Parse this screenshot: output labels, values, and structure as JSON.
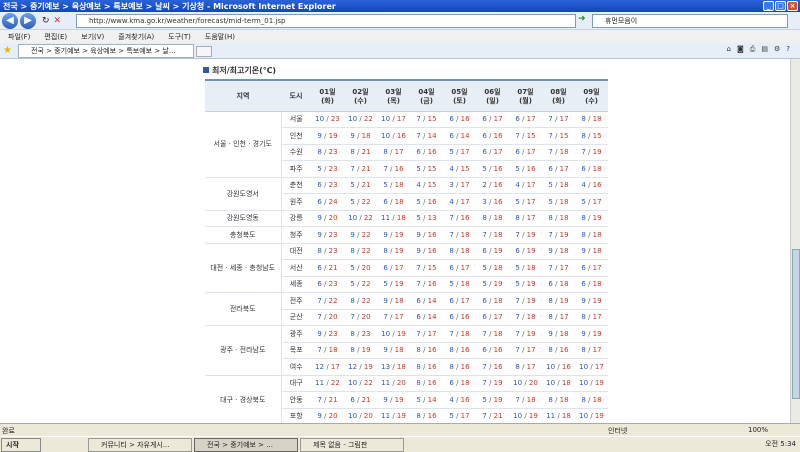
{
  "window": {
    "title": "전국 > 중기예보 > 육상예보 > 특보예보 > 날씨 > 기상청 - Microsoft Internet Explorer"
  },
  "addressbar": {
    "url": "http://www.kma.go.kr/weather/forecast/mid-term_01.jsp",
    "search": "휴먼모음이"
  },
  "menu": [
    "파일(F)",
    "편집(E)",
    "보기(V)",
    "즐겨찾기(A)",
    "도구(T)",
    "도움말(H)"
  ],
  "tab": {
    "label": "전국 > 중기예보 > 육상예보 > 특보예보 > 날..."
  },
  "section": {
    "title": "최저/최고기온(℃)"
  },
  "table": {
    "header_region": "지역",
    "header_city": "도시",
    "days": [
      {
        "day": "01일",
        "dow": "(화)"
      },
      {
        "day": "02일",
        "dow": "(수)"
      },
      {
        "day": "03일",
        "dow": "(목)"
      },
      {
        "day": "04일",
        "dow": "(금)"
      },
      {
        "day": "05일",
        "dow": "(토)"
      },
      {
        "day": "06일",
        "dow": "(일)"
      },
      {
        "day": "07일",
        "dow": "(월)"
      },
      {
        "day": "08일",
        "dow": "(화)"
      },
      {
        "day": "09일",
        "dow": "(수)"
      }
    ],
    "groups": [
      {
        "region": "서울 · 인천 · 경기도",
        "rows": [
          {
            "city": "서울",
            "v": [
              [
                "10",
                "23"
              ],
              [
                "10",
                "22"
              ],
              [
                "10",
                "17"
              ],
              [
                "7",
                "15"
              ],
              [
                "6",
                "16"
              ],
              [
                "6",
                "17"
              ],
              [
                "6",
                "17"
              ],
              [
                "7",
                "17"
              ],
              [
                "8",
                "18"
              ]
            ]
          },
          {
            "city": "인천",
            "v": [
              [
                "9",
                "19"
              ],
              [
                "9",
                "18"
              ],
              [
                "10",
                "16"
              ],
              [
                "7",
                "14"
              ],
              [
                "6",
                "14"
              ],
              [
                "6",
                "16"
              ],
              [
                "7",
                "15"
              ],
              [
                "7",
                "15"
              ],
              [
                "8",
                "15"
              ]
            ]
          },
          {
            "city": "수원",
            "v": [
              [
                "8",
                "23"
              ],
              [
                "8",
                "21"
              ],
              [
                "8",
                "17"
              ],
              [
                "6",
                "16"
              ],
              [
                "5",
                "17"
              ],
              [
                "6",
                "17"
              ],
              [
                "6",
                "17"
              ],
              [
                "7",
                "18"
              ],
              [
                "7",
                "19"
              ]
            ]
          },
          {
            "city": "파주",
            "v": [
              [
                "5",
                "23"
              ],
              [
                "7",
                "21"
              ],
              [
                "7",
                "16"
              ],
              [
                "5",
                "15"
              ],
              [
                "4",
                "15"
              ],
              [
                "5",
                "16"
              ],
              [
                "5",
                "16"
              ],
              [
                "6",
                "17"
              ],
              [
                "6",
                "18"
              ]
            ]
          }
        ]
      },
      {
        "region": "강원도영서",
        "rows": [
          {
            "city": "춘천",
            "v": [
              [
                "6",
                "23"
              ],
              [
                "5",
                "21"
              ],
              [
                "5",
                "18"
              ],
              [
                "4",
                "15"
              ],
              [
                "3",
                "17"
              ],
              [
                "2",
                "16"
              ],
              [
                "4",
                "17"
              ],
              [
                "5",
                "18"
              ],
              [
                "4",
                "16"
              ]
            ]
          },
          {
            "city": "원주",
            "v": [
              [
                "6",
                "24"
              ],
              [
                "5",
                "22"
              ],
              [
                "6",
                "18"
              ],
              [
                "5",
                "16"
              ],
              [
                "4",
                "17"
              ],
              [
                "3",
                "16"
              ],
              [
                "5",
                "17"
              ],
              [
                "5",
                "18"
              ],
              [
                "5",
                "17"
              ]
            ]
          }
        ]
      },
      {
        "region": "강원도영동",
        "rows": [
          {
            "city": "강릉",
            "v": [
              [
                "9",
                "20"
              ],
              [
                "10",
                "22"
              ],
              [
                "11",
                "18"
              ],
              [
                "5",
                "13"
              ],
              [
                "7",
                "16"
              ],
              [
                "8",
                "18"
              ],
              [
                "8",
                "17"
              ],
              [
                "8",
                "18"
              ],
              [
                "8",
                "19"
              ]
            ]
          }
        ]
      },
      {
        "region": "충청북도",
        "rows": [
          {
            "city": "청주",
            "v": [
              [
                "9",
                "23"
              ],
              [
                "9",
                "22"
              ],
              [
                "9",
                "19"
              ],
              [
                "9",
                "16"
              ],
              [
                "7",
                "18"
              ],
              [
                "7",
                "18"
              ],
              [
                "7",
                "19"
              ],
              [
                "7",
                "19"
              ],
              [
                "8",
                "18"
              ]
            ]
          }
        ]
      },
      {
        "region": "대전 · 세종 · 충청남도",
        "rows": [
          {
            "city": "대전",
            "v": [
              [
                "8",
                "23"
              ],
              [
                "8",
                "22"
              ],
              [
                "8",
                "19"
              ],
              [
                "9",
                "16"
              ],
              [
                "8",
                "18"
              ],
              [
                "6",
                "19"
              ],
              [
                "6",
                "19"
              ],
              [
                "9",
                "18"
              ],
              [
                "9",
                "18"
              ]
            ]
          },
          {
            "city": "서산",
            "v": [
              [
                "6",
                "21"
              ],
              [
                "5",
                "20"
              ],
              [
                "6",
                "17"
              ],
              [
                "7",
                "15"
              ],
              [
                "6",
                "17"
              ],
              [
                "5",
                "18"
              ],
              [
                "5",
                "18"
              ],
              [
                "7",
                "17"
              ],
              [
                "6",
                "17"
              ]
            ]
          },
          {
            "city": "세종",
            "v": [
              [
                "6",
                "23"
              ],
              [
                "5",
                "22"
              ],
              [
                "5",
                "19"
              ],
              [
                "7",
                "16"
              ],
              [
                "5",
                "18"
              ],
              [
                "5",
                "19"
              ],
              [
                "5",
                "19"
              ],
              [
                "6",
                "18"
              ],
              [
                "6",
                "18"
              ]
            ]
          }
        ]
      },
      {
        "region": "전라북도",
        "rows": [
          {
            "city": "전주",
            "v": [
              [
                "7",
                "22"
              ],
              [
                "8",
                "22"
              ],
              [
                "9",
                "18"
              ],
              [
                "6",
                "14"
              ],
              [
                "6",
                "17"
              ],
              [
                "6",
                "18"
              ],
              [
                "7",
                "19"
              ],
              [
                "8",
                "19"
              ],
              [
                "9",
                "19"
              ]
            ]
          },
          {
            "city": "군산",
            "v": [
              [
                "7",
                "20"
              ],
              [
                "7",
                "20"
              ],
              [
                "7",
                "17"
              ],
              [
                "6",
                "14"
              ],
              [
                "6",
                "16"
              ],
              [
                "6",
                "17"
              ],
              [
                "7",
                "18"
              ],
              [
                "8",
                "17"
              ],
              [
                "8",
                "17"
              ]
            ]
          }
        ]
      },
      {
        "region": "광주 · 전라남도",
        "rows": [
          {
            "city": "광주",
            "v": [
              [
                "9",
                "23"
              ],
              [
                "8",
                "23"
              ],
              [
                "10",
                "19"
              ],
              [
                "7",
                "17"
              ],
              [
                "7",
                "18"
              ],
              [
                "7",
                "18"
              ],
              [
                "7",
                "19"
              ],
              [
                "9",
                "18"
              ],
              [
                "9",
                "19"
              ]
            ]
          },
          {
            "city": "목포",
            "v": [
              [
                "7",
                "18"
              ],
              [
                "8",
                "19"
              ],
              [
                "9",
                "18"
              ],
              [
                "8",
                "16"
              ],
              [
                "8",
                "16"
              ],
              [
                "6",
                "16"
              ],
              [
                "7",
                "17"
              ],
              [
                "8",
                "16"
              ],
              [
                "8",
                "17"
              ]
            ]
          },
          {
            "city": "여수",
            "v": [
              [
                "12",
                "17"
              ],
              [
                "12",
                "19"
              ],
              [
                "13",
                "18"
              ],
              [
                "8",
                "16"
              ],
              [
                "8",
                "16"
              ],
              [
                "7",
                "16"
              ],
              [
                "8",
                "17"
              ],
              [
                "10",
                "16"
              ],
              [
                "10",
                "17"
              ]
            ]
          }
        ]
      },
      {
        "region": "대구 · 경상북도",
        "rows": [
          {
            "city": "대구",
            "v": [
              [
                "11",
                "22"
              ],
              [
                "10",
                "22"
              ],
              [
                "11",
                "20"
              ],
              [
                "8",
                "16"
              ],
              [
                "6",
                "18"
              ],
              [
                "7",
                "19"
              ],
              [
                "10",
                "20"
              ],
              [
                "10",
                "18"
              ],
              [
                "10",
                "19"
              ]
            ]
          },
          {
            "city": "안동",
            "v": [
              [
                "7",
                "21"
              ],
              [
                "6",
                "21"
              ],
              [
                "9",
                "19"
              ],
              [
                "5",
                "14"
              ],
              [
                "4",
                "16"
              ],
              [
                "5",
                "19"
              ],
              [
                "7",
                "18"
              ],
              [
                "8",
                "18"
              ],
              [
                "8",
                "18"
              ]
            ]
          },
          {
            "city": "포항",
            "v": [
              [
                "9",
                "20"
              ],
              [
                "10",
                "20"
              ],
              [
                "11",
                "19"
              ],
              [
                "8",
                "16"
              ],
              [
                "5",
                "17"
              ],
              [
                "7",
                "21"
              ],
              [
                "10",
                "19"
              ],
              [
                "11",
                "18"
              ],
              [
                "10",
                "19"
              ]
            ]
          }
        ]
      }
    ]
  },
  "status": {
    "left": "완료",
    "zone": "인터넷",
    "zoom": "100%"
  },
  "taskbar": {
    "start": "시작",
    "tasks": [
      "커뮤니티 > 자유게시...",
      "전국 > 중기예보 > ...",
      "제목 없음 - 그림판"
    ],
    "clock": "오전 5:34"
  }
}
